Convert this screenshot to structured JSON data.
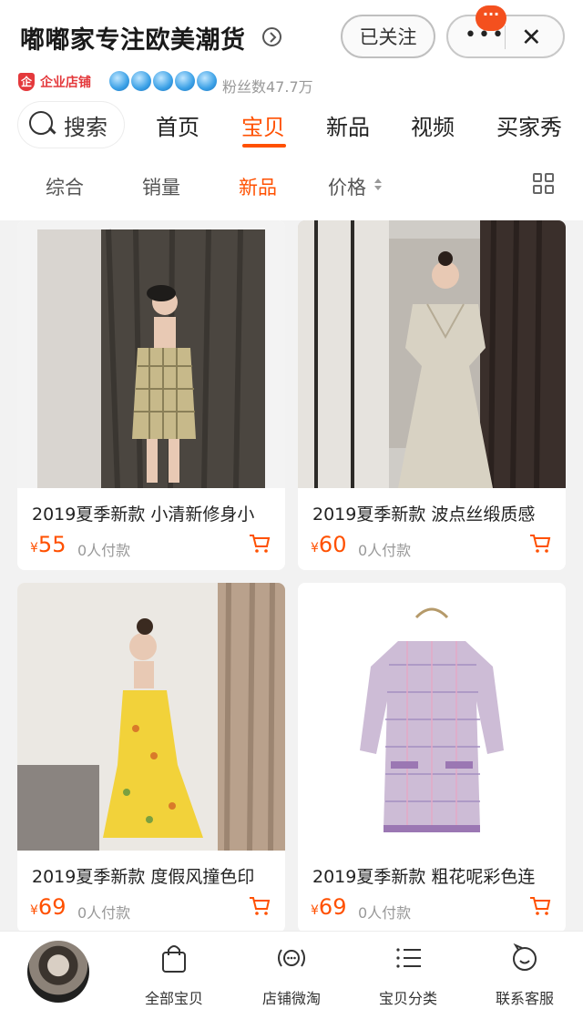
{
  "shop": {
    "name": "嘟嘟家专注欧美潮货",
    "follow_label": "已关注",
    "badge_text": "···",
    "enterprise_label": "企业店铺",
    "fans_text": "粉丝数47.7万",
    "crown_count": 5
  },
  "nav": {
    "search_label": "搜索",
    "tabs": [
      "首页",
      "宝贝",
      "新品",
      "视频",
      "买家秀"
    ],
    "active_tab": "宝贝"
  },
  "sort": {
    "tabs": [
      "综合",
      "销量",
      "新品",
      "价格"
    ],
    "active_tab": "新品"
  },
  "products": [
    {
      "title": "2019夏季新款 小清新修身小",
      "currency": "¥",
      "price": "55",
      "paid": "0人付款"
    },
    {
      "title": "2019夏季新款  波点丝缎质感",
      "currency": "¥",
      "price": "60",
      "paid": "0人付款"
    },
    {
      "title": "2019夏季新款 度假风撞色印",
      "currency": "¥",
      "price": "69",
      "paid": "0人付款"
    },
    {
      "title": "2019夏季新款 粗花呢彩色连",
      "currency": "¥",
      "price": "69",
      "paid": "0人付款"
    }
  ],
  "tabbar": {
    "items": [
      "全部宝贝",
      "店铺微淘",
      "宝贝分类",
      "联系客服"
    ]
  },
  "colors": {
    "accent": "#ff5000",
    "enterprise_red": "#e4393c",
    "crown_blue": "#3aa0e6"
  }
}
